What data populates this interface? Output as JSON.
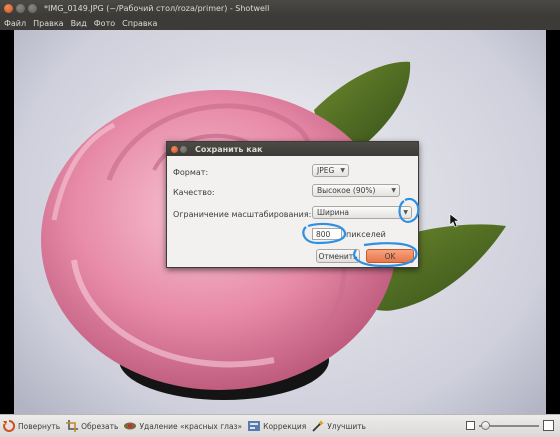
{
  "window": {
    "title": "*IMG_0149.JPG (~/Рабочий стол/roza/primer) - Shotwell"
  },
  "menu": [
    "Файл",
    "Правка",
    "Вид",
    "Фото",
    "Справка"
  ],
  "dialog": {
    "title": "Сохранить как",
    "format_label": "Формат:",
    "format_value": "JPEG",
    "quality_label": "Качество:",
    "quality_value": "Высокое (90%)",
    "scale_label": "Ограничение масштабирования:",
    "scale_value": "Ширина",
    "size_value": "800",
    "unit_label": "пикселей",
    "cancel_label": "Отменить",
    "ok_label": "OK"
  },
  "toolbar": {
    "rotate_label": "Повернуть",
    "crop_label": "Обрезать",
    "redeye_label": "Удаление «красных глаз»",
    "adjust_label": "Коррекция",
    "enhance_label": "Улучшить"
  },
  "colors": {
    "accent": "#e8764a",
    "annotation": "#2f8fe0",
    "chrome_dark": "#3c3b37"
  },
  "icons": {
    "rotate": "rotate-icon",
    "crop": "crop-icon",
    "redeye": "red-eye-icon",
    "adjust": "adjust-icon",
    "enhance": "enhance-icon",
    "zoom_out": "zoom-out-icon",
    "zoom_in": "zoom-in-icon"
  }
}
